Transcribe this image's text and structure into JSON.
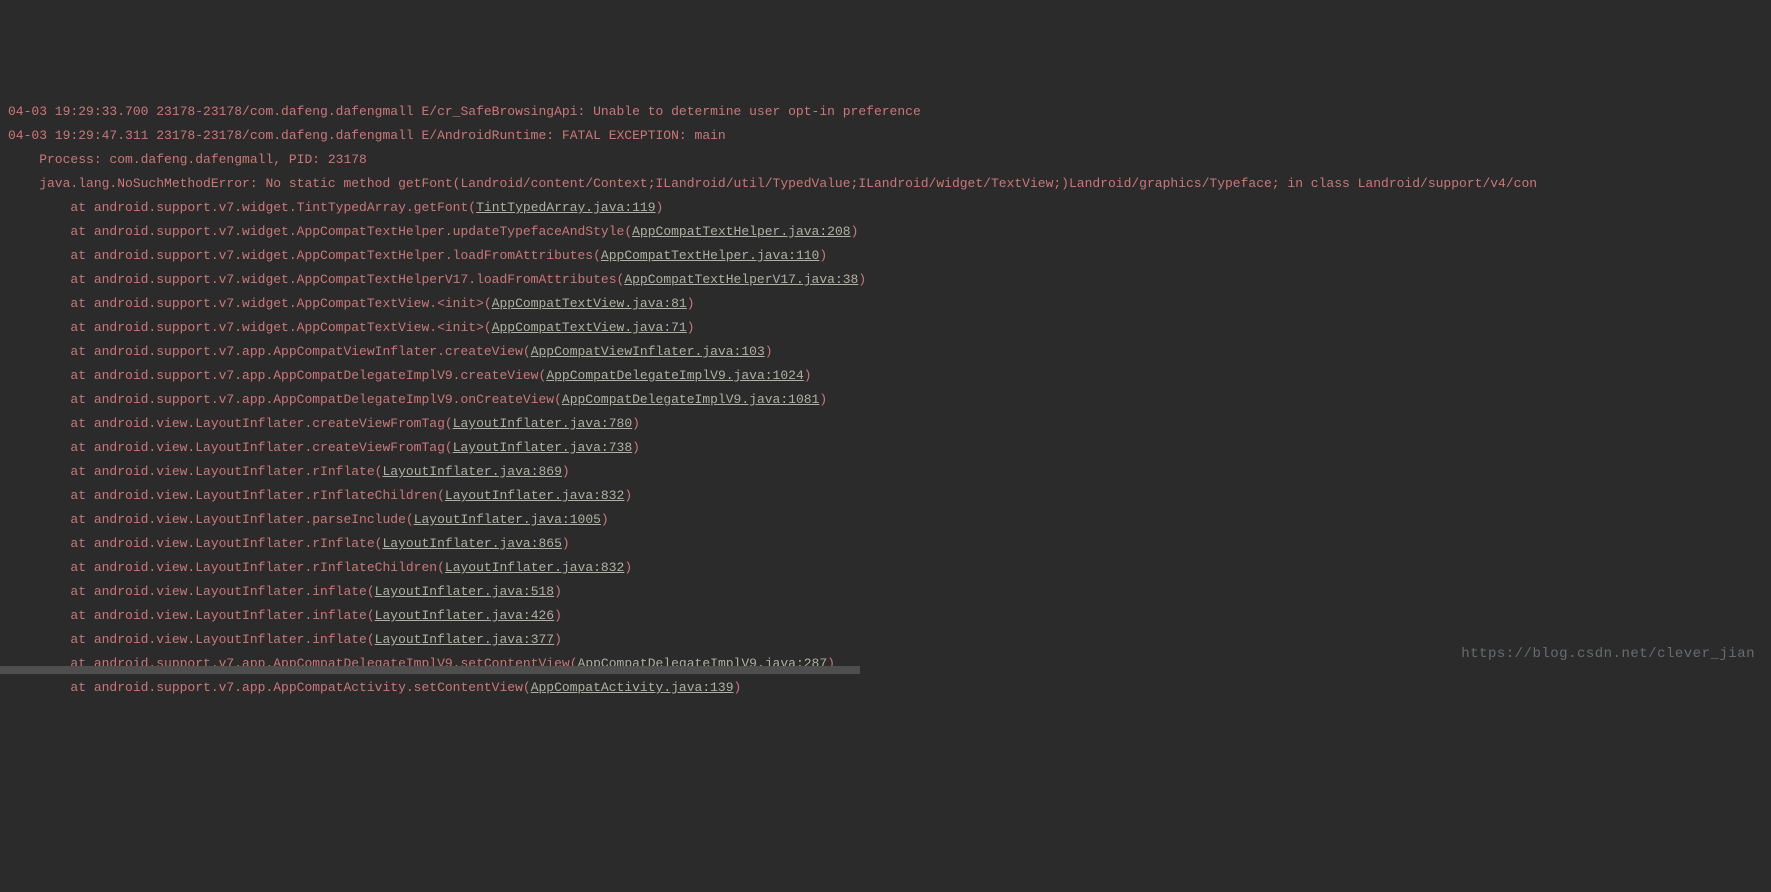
{
  "watermark": "https://blog.csdn.net/clever_jian",
  "lines": [
    {
      "prefix": "04-03 19:29:33.700 23178-23178/com.dafeng.dafengmall E/cr_SafeBrowsingApi: Unable to determine user opt-in preference"
    },
    {
      "prefix": "04-03 19:29:47.311 23178-23178/com.dafeng.dafengmall E/AndroidRuntime: FATAL EXCEPTION: main"
    },
    {
      "prefix": "    Process: com.dafeng.dafengmall, PID: 23178"
    },
    {
      "prefix": "    java.lang.NoSuchMethodError: No static method getFont(Landroid/content/Context;ILandroid/util/TypedValue;ILandroid/widget/TextView;)Landroid/graphics/Typeface; in class Landroid/support/v4/con"
    },
    {
      "prefix": "        at android.support.v7.widget.TintTypedArray.getFont",
      "link": "TintTypedArray.java:119"
    },
    {
      "prefix": "        at android.support.v7.widget.AppCompatTextHelper.updateTypefaceAndStyle",
      "link": "AppCompatTextHelper.java:208"
    },
    {
      "prefix": "        at android.support.v7.widget.AppCompatTextHelper.loadFromAttributes",
      "link": "AppCompatTextHelper.java:110"
    },
    {
      "prefix": "        at android.support.v7.widget.AppCompatTextHelperV17.loadFromAttributes",
      "link": "AppCompatTextHelperV17.java:38"
    },
    {
      "prefix": "        at android.support.v7.widget.AppCompatTextView.<init>",
      "link": "AppCompatTextView.java:81"
    },
    {
      "prefix": "        at android.support.v7.widget.AppCompatTextView.<init>",
      "link": "AppCompatTextView.java:71"
    },
    {
      "prefix": "        at android.support.v7.app.AppCompatViewInflater.createView",
      "link": "AppCompatViewInflater.java:103"
    },
    {
      "prefix": "        at android.support.v7.app.AppCompatDelegateImplV9.createView",
      "link": "AppCompatDelegateImplV9.java:1024"
    },
    {
      "prefix": "        at android.support.v7.app.AppCompatDelegateImplV9.onCreateView",
      "link": "AppCompatDelegateImplV9.java:1081"
    },
    {
      "prefix": "        at android.view.LayoutInflater.createViewFromTag",
      "link": "LayoutInflater.java:780"
    },
    {
      "prefix": "        at android.view.LayoutInflater.createViewFromTag",
      "link": "LayoutInflater.java:738"
    },
    {
      "prefix": "        at android.view.LayoutInflater.rInflate",
      "link": "LayoutInflater.java:869"
    },
    {
      "prefix": "        at android.view.LayoutInflater.rInflateChildren",
      "link": "LayoutInflater.java:832"
    },
    {
      "prefix": "        at android.view.LayoutInflater.parseInclude",
      "link": "LayoutInflater.java:1005"
    },
    {
      "prefix": "        at android.view.LayoutInflater.rInflate",
      "link": "LayoutInflater.java:865"
    },
    {
      "prefix": "        at android.view.LayoutInflater.rInflateChildren",
      "link": "LayoutInflater.java:832"
    },
    {
      "prefix": "        at android.view.LayoutInflater.inflate",
      "link": "LayoutInflater.java:518"
    },
    {
      "prefix": "        at android.view.LayoutInflater.inflate",
      "link": "LayoutInflater.java:426"
    },
    {
      "prefix": "        at android.view.LayoutInflater.inflate",
      "link": "LayoutInflater.java:377"
    },
    {
      "prefix": "        at android.support.v7.app.AppCompatDelegateImplV9.setContentView",
      "link": "AppCompatDelegateImplV9.java:287"
    },
    {
      "prefix": "        at android.support.v7.app.AppCompatActivity.setContentView",
      "link": "AppCompatActivity.java:139"
    }
  ]
}
